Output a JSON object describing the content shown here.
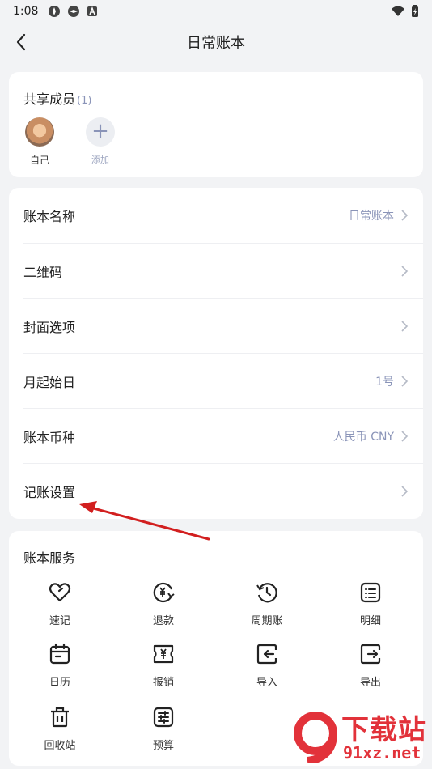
{
  "status": {
    "time": "1:08"
  },
  "nav": {
    "title": "日常账本"
  },
  "members": {
    "header": "共享成员",
    "count": "(1)",
    "self_label": "自己",
    "add_label": "添加",
    "add_symbol": "+"
  },
  "settings": {
    "rows": [
      {
        "label": "账本名称",
        "value": "日常账本"
      },
      {
        "label": "二维码",
        "value": ""
      },
      {
        "label": "封面选项",
        "value": ""
      },
      {
        "label": "月起始日",
        "value": "1号"
      },
      {
        "label": "账本币种",
        "value": "人民币 CNY"
      },
      {
        "label": "记账设置",
        "value": ""
      }
    ]
  },
  "services": {
    "header": "账本服务",
    "items": [
      {
        "label": "速记",
        "icon": "heart-edit-icon"
      },
      {
        "label": "退款",
        "icon": "refund-icon"
      },
      {
        "label": "周期账",
        "icon": "cycle-clock-icon"
      },
      {
        "label": "明细",
        "icon": "list-detail-icon"
      },
      {
        "label": "日历",
        "icon": "calendar-icon"
      },
      {
        "label": "报销",
        "icon": "reimburse-icon"
      },
      {
        "label": "导入",
        "icon": "import-icon"
      },
      {
        "label": "导出",
        "icon": "export-icon"
      },
      {
        "label": "回收站",
        "icon": "trash-icon"
      },
      {
        "label": "预算",
        "icon": "budget-icon"
      }
    ]
  },
  "watermark": {
    "line1": "下载站",
    "line2": "91xz.net"
  },
  "colors": {
    "accent_text": "#8a94b8",
    "annotation_arrow": "#d21f1f",
    "watermark": "#e2323a"
  }
}
